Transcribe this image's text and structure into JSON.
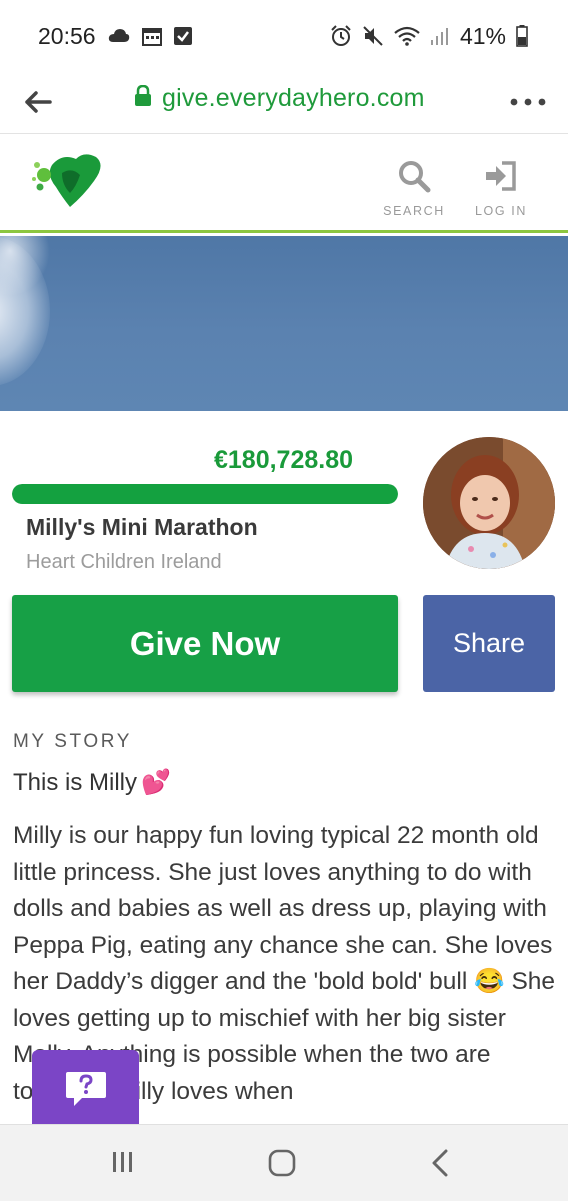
{
  "status_bar": {
    "time": "20:56",
    "battery": "41%",
    "left_icons": [
      "cloud-icon",
      "calendar-icon",
      "checkbox-icon"
    ],
    "right_icons": [
      "alarm-icon",
      "mute-icon",
      "wifi-icon",
      "signal-icon",
      "battery-icon"
    ]
  },
  "browser": {
    "url": "give.everydayhero.com",
    "back_icon": "back-arrow-icon",
    "menu_icon": "more-dots-icon"
  },
  "header": {
    "search_label": "SEARCH",
    "login_label": "LOG IN"
  },
  "fundraiser": {
    "amount": "€180,728.80",
    "progress_fraction": 1.0,
    "title": "Milly's Mini Marathon",
    "charity": "Heart Children Ireland"
  },
  "actions": {
    "give_label": "Give Now",
    "share_label": "Share"
  },
  "story": {
    "label": "MY STORY",
    "title": "This is Milly",
    "title_emoji": "💕",
    "body_parts": [
      "Milly is our happy fun loving typical 22 month old little princess. She just loves anything to do with dolls and babies as well as dress up, playing with Peppa Pig, eating any chance she can. She loves her Daddy’s digger and the 'bold bold' bull ",
      "😂",
      " She loves getting up to mischief with her big sister Molly. Anything is possible when the two are together. Milly loves when"
    ]
  },
  "colors": {
    "brand_green": "#17a046",
    "url_green": "#1f9a3b",
    "share_blue": "#4b64a6",
    "help_purple": "#7b45c6"
  }
}
